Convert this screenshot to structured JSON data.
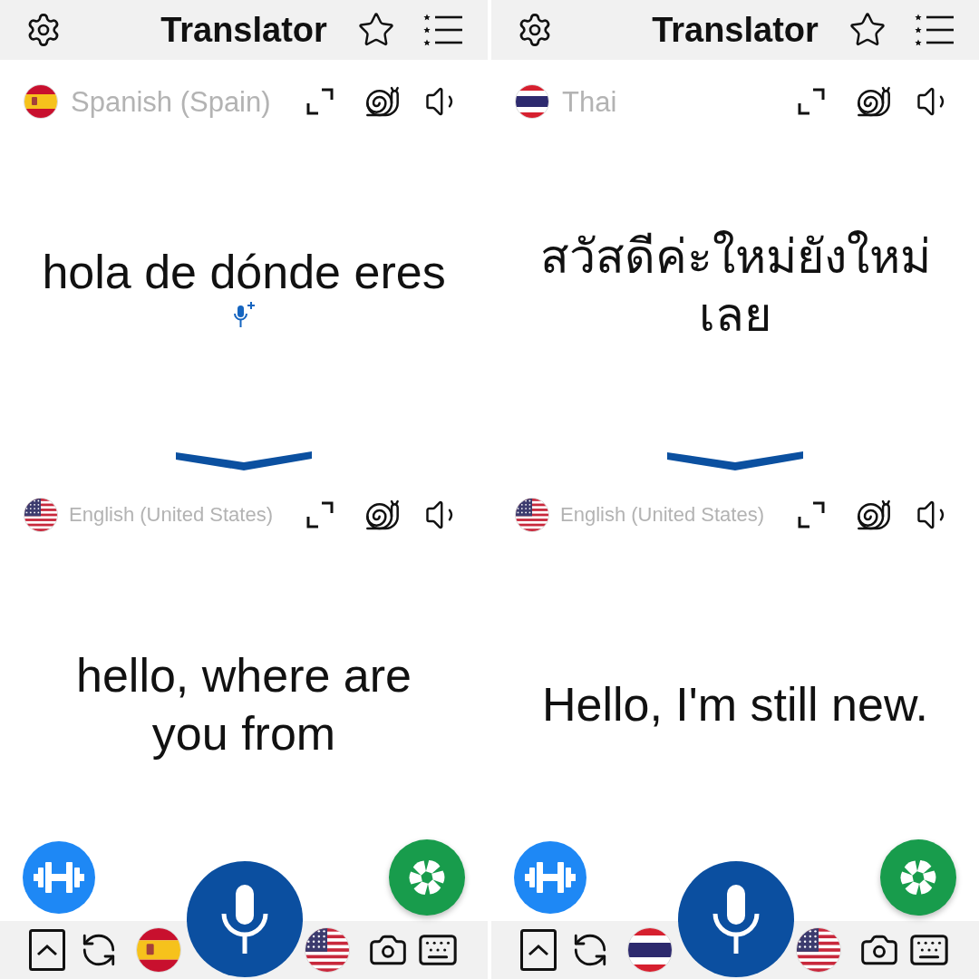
{
  "panels": [
    {
      "header": {
        "title": "Translator"
      },
      "source": {
        "language": "Spanish (Spain)",
        "flag": {
          "kind": "spain"
        },
        "text": "hola de dónde eres",
        "append_voice": true
      },
      "target": {
        "language": "English (United States)",
        "flag": {
          "kind": "usa"
        },
        "text": "hello, where are you from"
      }
    },
    {
      "header": {
        "title": "Translator"
      },
      "source": {
        "language": "Thai",
        "flag": {
          "kind": "thailand"
        },
        "text": "สวัสดีค่ะใหม่ยังใหม่เลย",
        "append_voice": false
      },
      "target": {
        "language": "English (United States)",
        "flag": {
          "kind": "usa"
        },
        "text": "Hello, I'm still new."
      }
    }
  ]
}
